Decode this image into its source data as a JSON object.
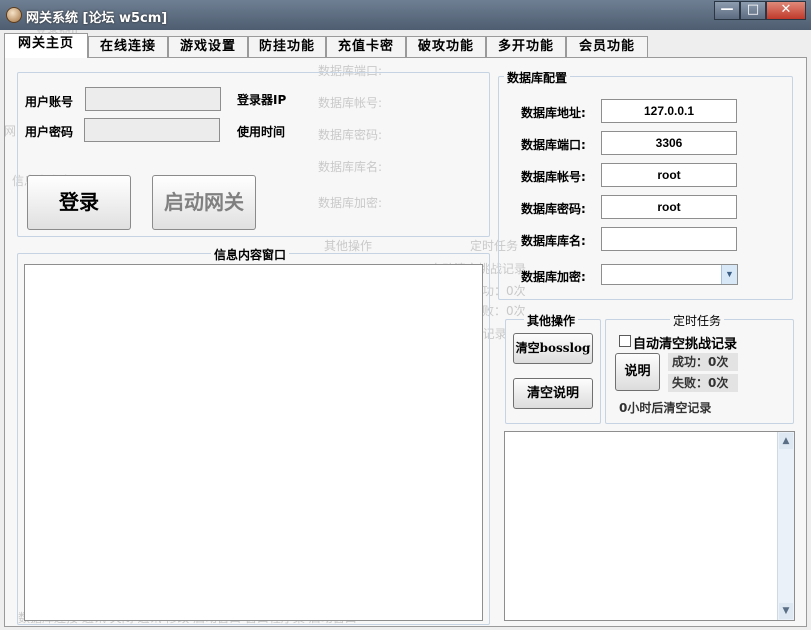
{
  "window": {
    "title": "网关系统 [论坛 w5cm]",
    "minimize_glyph": "—",
    "maximize_glyph": "□",
    "close_glyph": "✕"
  },
  "tabs": [
    "网关主页",
    "在线连接",
    "游戏设置",
    "防挂功能",
    "充值卡密",
    "破攻功能",
    "多开功能",
    "会员功能"
  ],
  "login": {
    "account_label": "用户账号",
    "password_label": "用户密码",
    "ip_label": "登录器IP",
    "time_label": "使用时间",
    "login_button": "登录",
    "start_button": "启动网关"
  },
  "info_window": {
    "title": "信息内容窗口"
  },
  "db_config": {
    "title": "数据库配置",
    "fields": [
      {
        "label": "数据库地址:",
        "value": "127.0.0.1"
      },
      {
        "label": "数据库端口:",
        "value": "3306"
      },
      {
        "label": "数据库帐号:",
        "value": "root"
      },
      {
        "label": "数据库密码:",
        "value": "root"
      },
      {
        "label": "数据库库名:",
        "value": ""
      },
      {
        "label": "数据库加密:",
        "value": ""
      }
    ]
  },
  "other_ops": {
    "title": "其他操作",
    "clear_bosslog": "清空bosslog",
    "clear_desc": "清空说明"
  },
  "scheduled": {
    "title": "定时任务",
    "auto_clear_label": "自动清空挑战记录",
    "auto_clear_checked": false,
    "explain_button": "说明",
    "success": "成功：0次",
    "failure": "失败：0次",
    "schedule_text": "0小时后清空记录"
  },
  "ghost_text": {
    "db_config": "数据库配置",
    "login_bg": "登录器IP",
    "use_time": "使用时间",
    "info_bg": "信息内容窗口",
    "pwd_short": "网",
    "port": "数据库端口:",
    "account": "数据库帐号:",
    "password": "数据库密码:",
    "dbname": "数据库库名:",
    "encrypt": "数据库加密:",
    "other_ops": "其他操作",
    "clear": "清空",
    "bosslog": "bosslog",
    "clear_desc": "清空说明",
    "scheduled": "定时任务",
    "auto_clear": "自动清空挑战记录",
    "explain": "说明",
    "success": "成功：0次",
    "failure": "失败：0次",
    "hours": "0小时后清空记录",
    "bottom": "数据库连接   通讯 关闭   通讯 修改   启动窗口   窗口程序集 启动窗口"
  }
}
